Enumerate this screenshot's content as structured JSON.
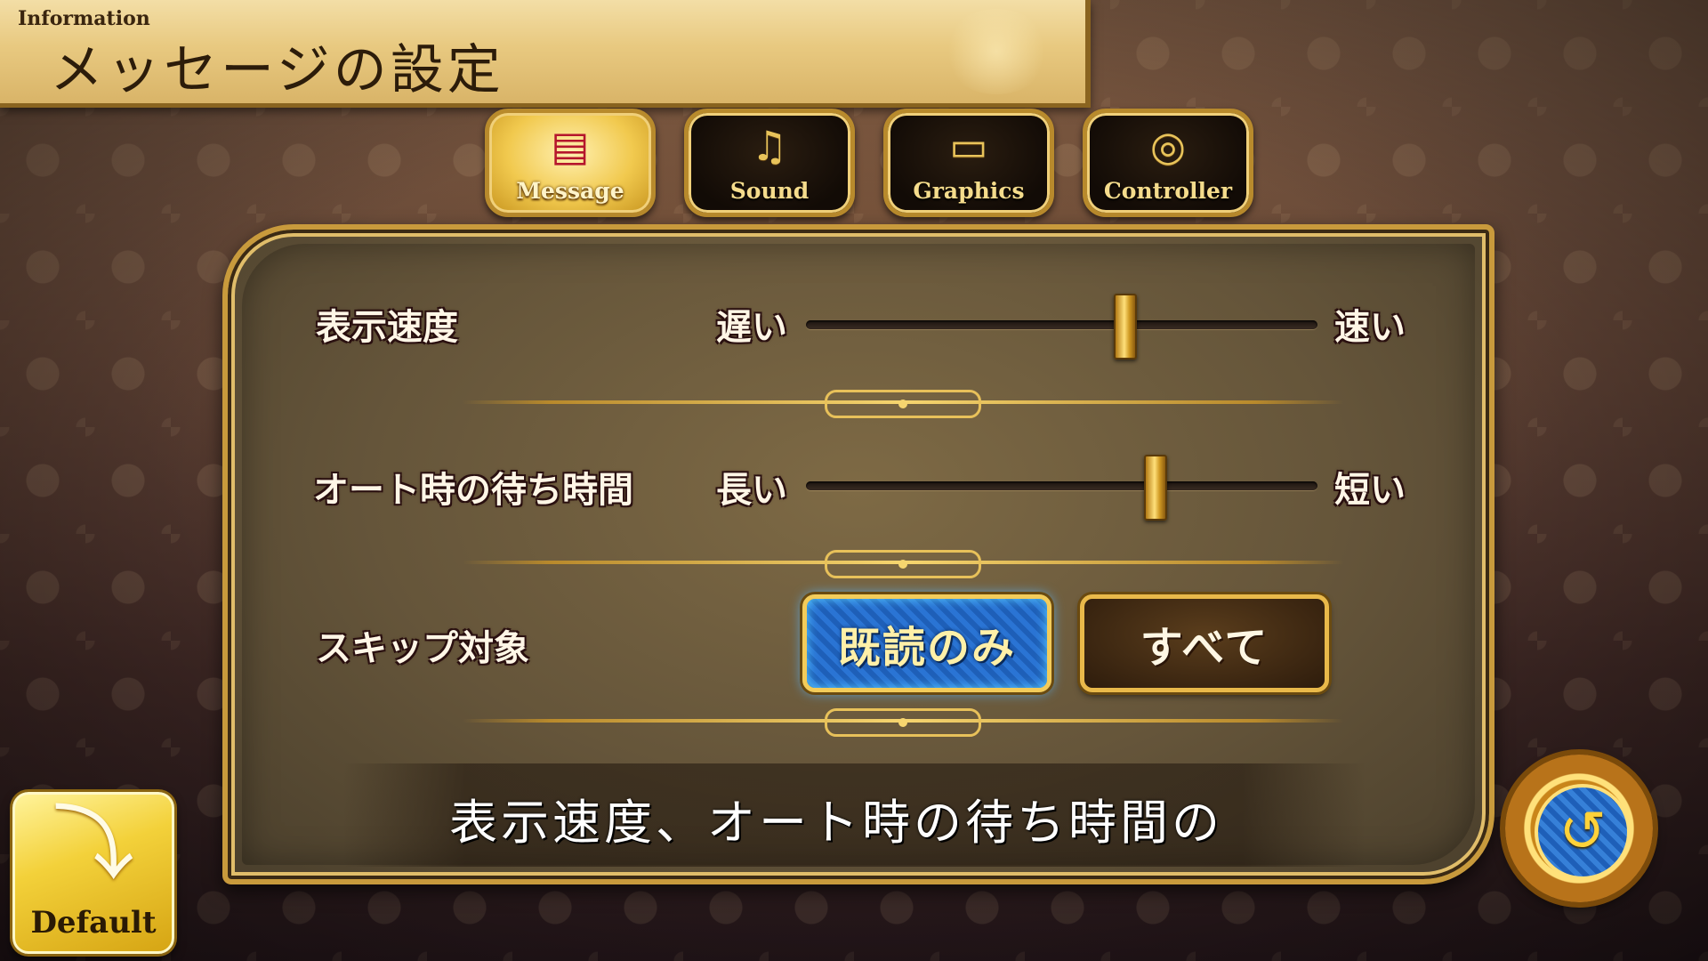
{
  "header": {
    "subtitle": "Information",
    "title": "メッセージの設定"
  },
  "tabs": [
    {
      "label": "Message",
      "icon": "message-icon",
      "active": true
    },
    {
      "label": "Sound",
      "icon": "sound-icon",
      "active": false
    },
    {
      "label": "Graphics",
      "icon": "graphics-icon",
      "active": false
    },
    {
      "label": "Controller",
      "icon": "controller-icon",
      "active": false
    }
  ],
  "settings": {
    "text_speed": {
      "label": "表示速度",
      "min_label": "遅い",
      "max_label": "速い",
      "value": 0.62
    },
    "auto_wait": {
      "label": "オート時の待ち時間",
      "min_label": "長い",
      "max_label": "短い",
      "value": 0.68
    },
    "skip_target": {
      "label": "スキップ対象",
      "options": [
        "既読のみ",
        "すべて"
      ],
      "selected": "既読のみ"
    }
  },
  "description": "表示速度、オート時の待ち時間の",
  "buttons": {
    "default_label": "Default",
    "back_icon": "refresh-icon"
  },
  "colors": {
    "accent_gold": "#f3cc5a",
    "selected_blue": "#2a74d4"
  }
}
